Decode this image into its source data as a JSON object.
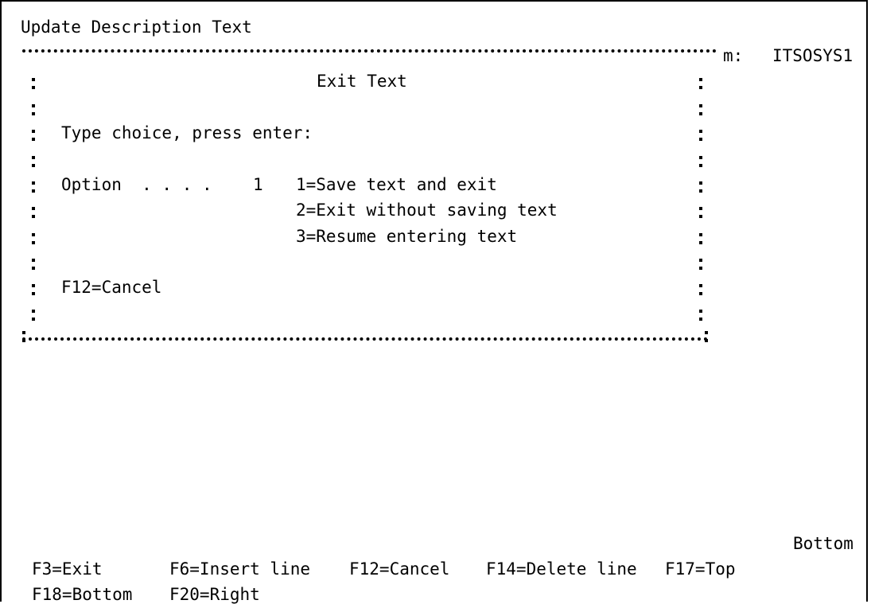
{
  "screen_title": "Update Description Text",
  "system": {
    "label": "m:",
    "name": "ITSOSYS1"
  },
  "popup": {
    "title": "Exit Text",
    "instruction": "Type choice, press enter:",
    "option_label": "Option  . . . .",
    "option_value": "1",
    "choices": [
      "1=Save text and exit",
      "2=Exit without saving text",
      "3=Resume entering text"
    ],
    "function_key": "F12=Cancel"
  },
  "status": "Bottom",
  "function_keys": [
    "F3=Exit",
    "F6=Insert line",
    "F12=Cancel",
    "F14=Delete line",
    "F17=Top",
    "F18=Bottom",
    "F20=Right"
  ]
}
